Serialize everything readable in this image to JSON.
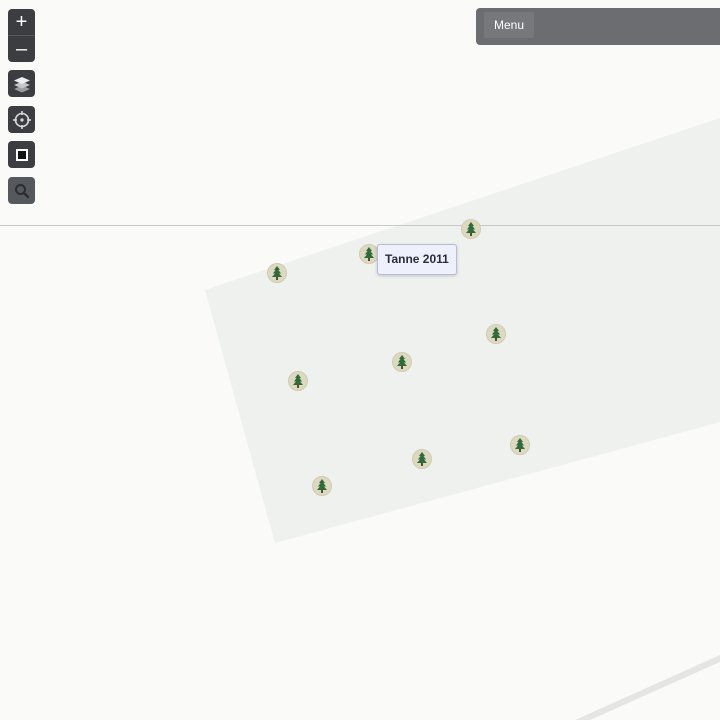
{
  "controls": {
    "zoom_in_label": "+",
    "zoom_out_label": "–"
  },
  "menu": {
    "label": "Menu"
  },
  "tooltip": {
    "label": "Tanne 2011"
  },
  "markers": [
    {
      "name": "tree-marker-1",
      "icon": "tree-icon"
    },
    {
      "name": "tree-marker-2",
      "icon": "tree-icon"
    },
    {
      "name": "tree-marker-3",
      "icon": "tree-icon"
    },
    {
      "name": "tree-marker-4",
      "icon": "tree-icon"
    },
    {
      "name": "tree-marker-5",
      "icon": "tree-icon"
    },
    {
      "name": "tree-marker-6",
      "icon": "tree-icon"
    },
    {
      "name": "tree-marker-7",
      "icon": "tree-icon"
    },
    {
      "name": "tree-marker-8",
      "icon": "tree-icon"
    },
    {
      "name": "tree-marker-9",
      "icon": "tree-icon"
    },
    {
      "name": "tree-marker-10",
      "icon": "tree-icon"
    }
  ],
  "colors": {
    "map_background": "#fafaf8",
    "parcel_fill": "#eef1ed",
    "control_background": "#3b3d41",
    "marker_fill": "#dcd9c0",
    "tree_green": "#2f6a3a",
    "tooltip_background": "#eef0fb"
  }
}
